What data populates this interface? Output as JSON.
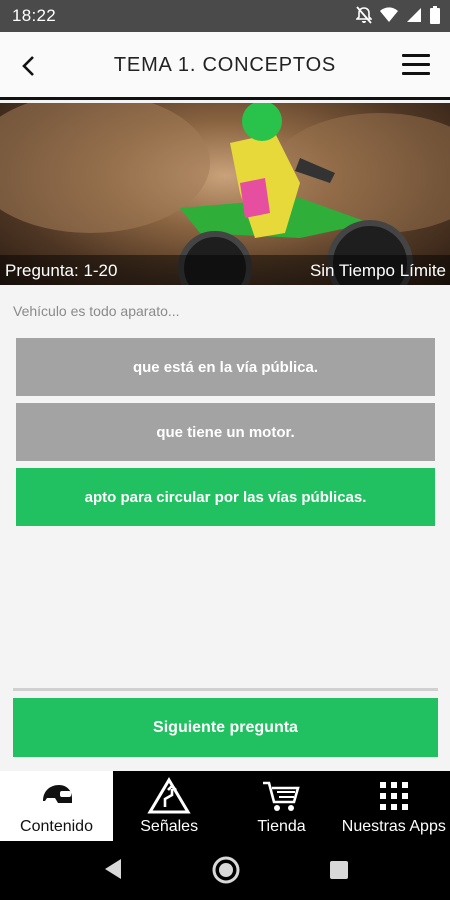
{
  "status_bar": {
    "time": "18:22",
    "icons": [
      "notifications-off-icon",
      "wifi-icon",
      "signal-icon",
      "battery-icon"
    ]
  },
  "header": {
    "title": "TEMA 1. CONCEPTOS",
    "back_icon": "chevron-left-icon",
    "menu_icon": "hamburger-menu-icon"
  },
  "banner": {
    "question_range": "Pregunta: 1-20",
    "time_mode": "Sin Tiempo Límite"
  },
  "quiz": {
    "question": "Vehículo es todo aparato...",
    "answers": [
      {
        "text": "que está en la vía pública.",
        "state": "neutral"
      },
      {
        "text": "que tiene un motor.",
        "state": "neutral"
      },
      {
        "text": "apto para circular por las vías públicas.",
        "state": "correct"
      }
    ],
    "next_label": "Siguiente pregunta"
  },
  "bottom_nav": {
    "items": [
      {
        "label": "Contenido",
        "icon": "helmet-icon",
        "active": true
      },
      {
        "label": "Señales",
        "icon": "road-sign-icon",
        "active": false
      },
      {
        "label": "Tienda",
        "icon": "cart-icon",
        "active": false
      },
      {
        "label": "Nuestras Apps",
        "icon": "apps-grid-icon",
        "active": false
      }
    ]
  },
  "system_nav": [
    "back-triangle-icon",
    "home-circle-icon",
    "recents-square-icon"
  ],
  "colors": {
    "status_bar": "#4a4a4a",
    "neutral_answer": "#a3a3a3",
    "accent_green": "#21c162",
    "nav_background": "#000000"
  }
}
